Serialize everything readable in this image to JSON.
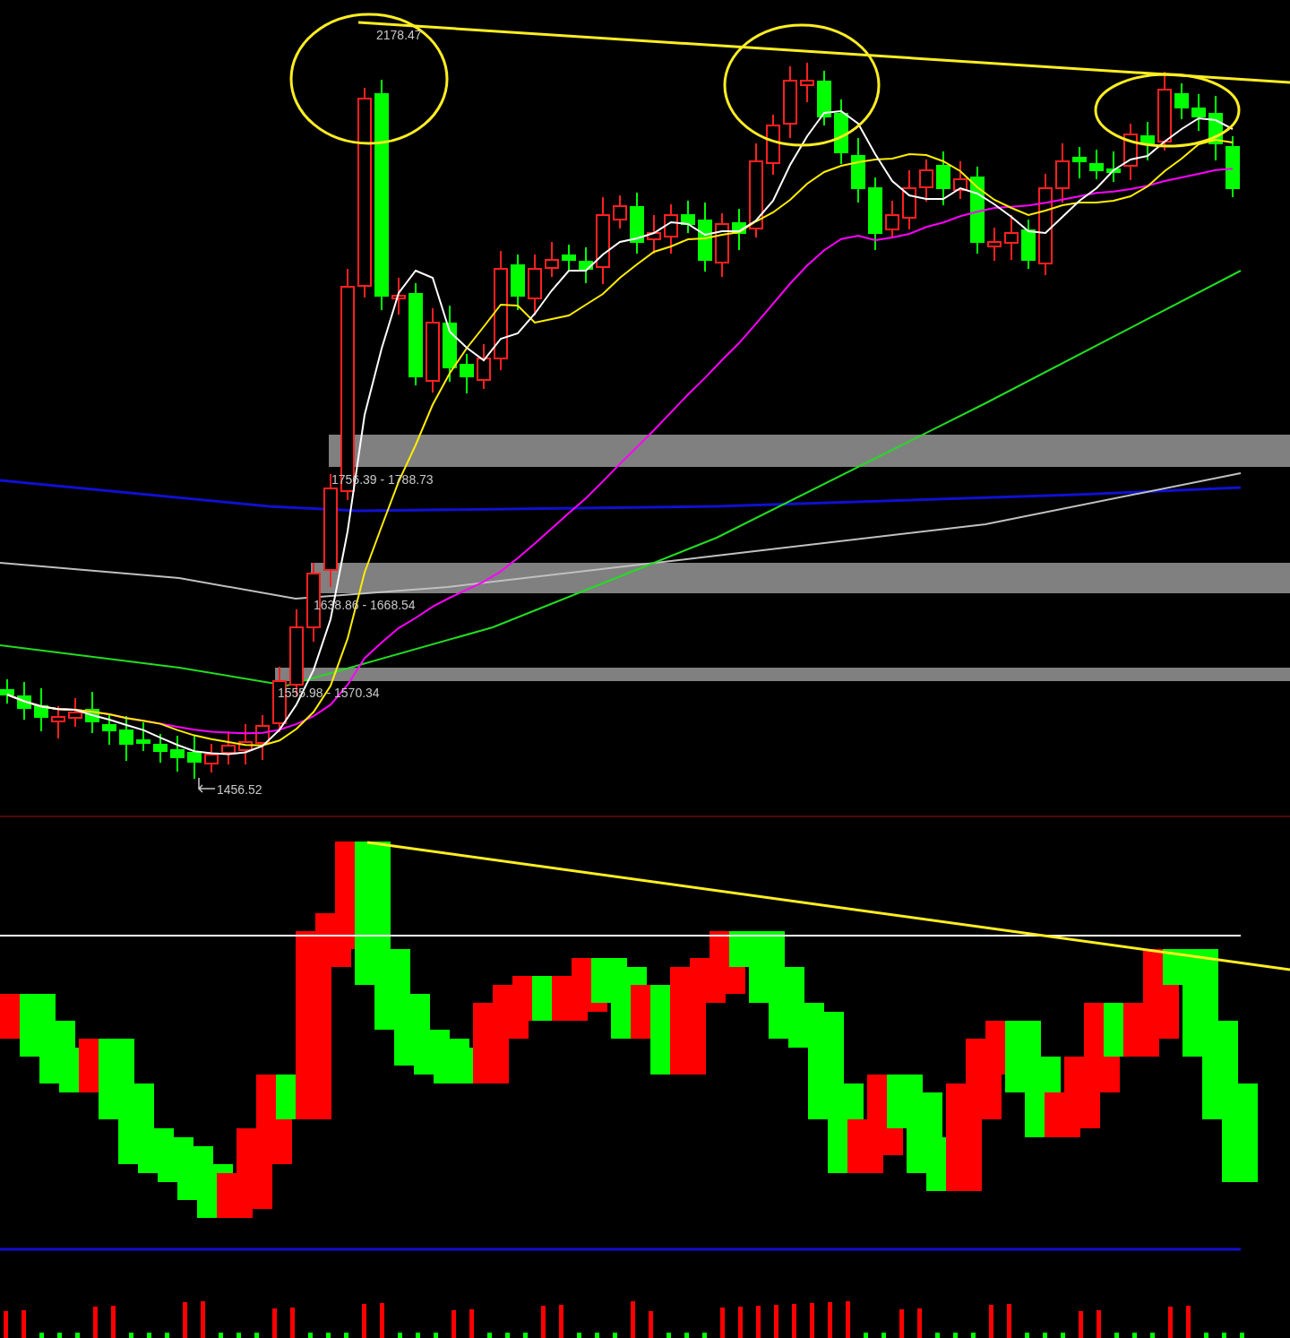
{
  "price_panel": {
    "peak_label": "2178.47",
    "gap_labels": [
      "1756.39 - 1788.73",
      "1638.86 - 1668.54",
      "1555.98 - 1570.34"
    ],
    "low_label": "1456.52"
  }
}
